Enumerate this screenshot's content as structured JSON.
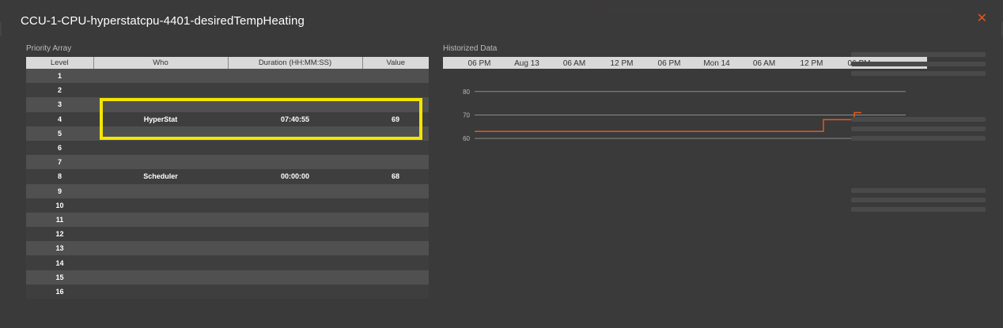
{
  "modal": {
    "title": "CCU-1-CPU-hyperstatcpu-4401-desiredTempHeating",
    "close_icon": "close-icon"
  },
  "priority_array": {
    "label": "Priority Array",
    "headers": {
      "level": "Level",
      "who": "Who",
      "duration": "Duration (HH:MM:SS)",
      "value": "Value"
    },
    "rows": [
      {
        "level": "1",
        "who": "",
        "duration": "",
        "value": ""
      },
      {
        "level": "2",
        "who": "",
        "duration": "",
        "value": ""
      },
      {
        "level": "3",
        "who": "",
        "duration": "",
        "value": ""
      },
      {
        "level": "4",
        "who": "HyperStat",
        "duration": "07:40:55",
        "value": "69"
      },
      {
        "level": "5",
        "who": "",
        "duration": "",
        "value": ""
      },
      {
        "level": "6",
        "who": "",
        "duration": "",
        "value": ""
      },
      {
        "level": "7",
        "who": "",
        "duration": "",
        "value": ""
      },
      {
        "level": "8",
        "who": "Scheduler",
        "duration": "00:00:00",
        "value": "68"
      },
      {
        "level": "9",
        "who": "",
        "duration": "",
        "value": ""
      },
      {
        "level": "10",
        "who": "",
        "duration": "",
        "value": ""
      },
      {
        "level": "11",
        "who": "",
        "duration": "",
        "value": ""
      },
      {
        "level": "12",
        "who": "",
        "duration": "",
        "value": ""
      },
      {
        "level": "13",
        "who": "",
        "duration": "",
        "value": ""
      },
      {
        "level": "14",
        "who": "",
        "duration": "",
        "value": ""
      },
      {
        "level": "15",
        "who": "",
        "duration": "",
        "value": ""
      },
      {
        "level": "16",
        "who": "",
        "duration": "",
        "value": ""
      }
    ]
  },
  "historized": {
    "label": "Historized Data",
    "line_color": "#e35a1c",
    "chart_data": {
      "type": "line",
      "x_ticks": [
        "06 PM",
        "Aug 13",
        "06 AM",
        "12 PM",
        "06 PM",
        "Mon 14",
        "06 AM",
        "12 PM",
        "06 PM"
      ],
      "y_ticks": [
        60,
        70,
        80
      ],
      "ylim": [
        57,
        86
      ],
      "grid": true,
      "series": [
        {
          "x": [
            0,
            7.25,
            7.25,
            7.9,
            7.9,
            8.05
          ],
          "values": [
            63,
            63,
            68,
            68,
            71,
            71
          ]
        }
      ]
    }
  }
}
